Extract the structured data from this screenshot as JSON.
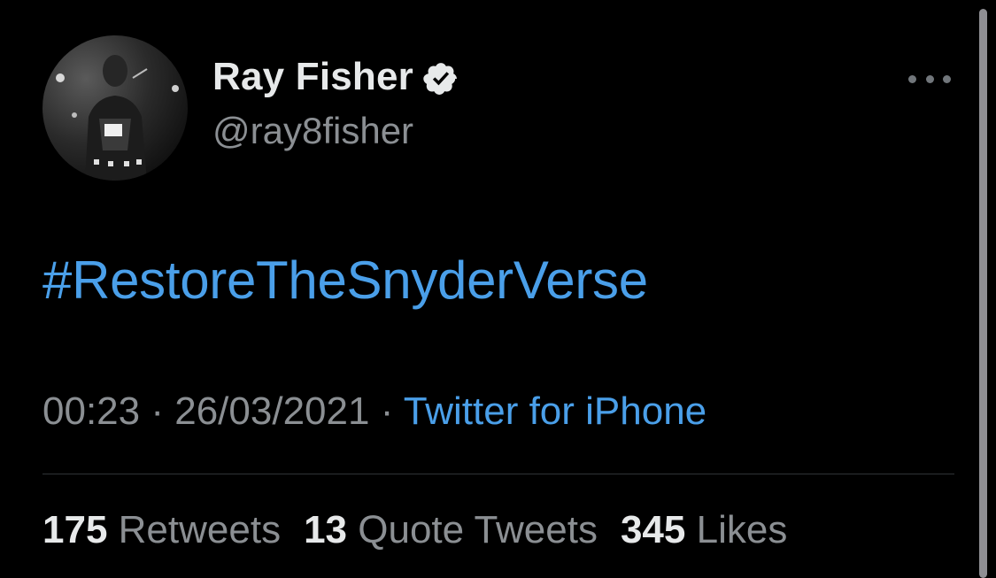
{
  "author": {
    "display_name": "Ray Fisher",
    "handle": "@ray8fisher",
    "verified": true,
    "avatar_icon": "profile-photo"
  },
  "tweet": {
    "text": "#RestoreTheSnyderVerse",
    "time": "00:23",
    "separator": "·",
    "date": "26/03/2021",
    "source": "Twitter for iPhone"
  },
  "stats": {
    "retweets_count": "175",
    "retweets_label": "Retweets",
    "quotes_count": "13",
    "quotes_label": "Quote Tweets",
    "likes_count": "345",
    "likes_label": "Likes"
  },
  "colors": {
    "background": "#000000",
    "link": "#4a9fe9",
    "secondary_text": "#8b8f93",
    "primary_text": "#e7e9ea"
  },
  "icons": {
    "more": "more-horizontal-icon",
    "verified": "verified-badge-icon"
  }
}
